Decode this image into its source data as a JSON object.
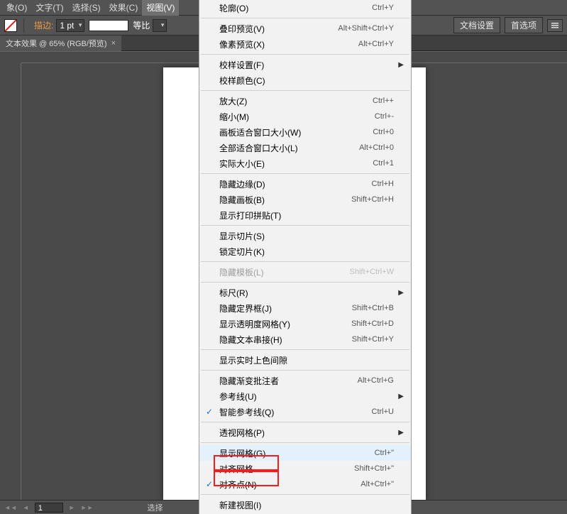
{
  "menubar": {
    "items": [
      {
        "label": "象(O)"
      },
      {
        "label": "文字(T)"
      },
      {
        "label": "选择(S)"
      },
      {
        "label": "效果(C)"
      },
      {
        "label": "视图(V)",
        "active": true
      }
    ]
  },
  "toolbar": {
    "stroke_label": "描边:",
    "stroke_size": "1 pt",
    "uniform_label": "等比",
    "doc_setup": "文档设置",
    "preferences": "首选项"
  },
  "doc_tab": {
    "title": "文本效果 @ 65% (RGB/预览)",
    "close": "×"
  },
  "status": {
    "page": "1",
    "mode_label": "选择"
  },
  "dropdown": {
    "groups": [
      {
        "items": [
          {
            "label": "轮廓(O)",
            "accel": "Ctrl+Y"
          }
        ]
      },
      {
        "items": [
          {
            "label": "叠印预览(V)",
            "accel": "Alt+Shift+Ctrl+Y"
          },
          {
            "label": "像素预览(X)",
            "accel": "Alt+Ctrl+Y"
          }
        ]
      },
      {
        "items": [
          {
            "label": "校样设置(F)",
            "submenu": true
          },
          {
            "label": "校样颜色(C)"
          }
        ]
      },
      {
        "items": [
          {
            "label": "放大(Z)",
            "accel": "Ctrl++"
          },
          {
            "label": "缩小(M)",
            "accel": "Ctrl+-"
          },
          {
            "label": "画板适合窗口大小(W)",
            "accel": "Ctrl+0"
          },
          {
            "label": "全部适合窗口大小(L)",
            "accel": "Alt+Ctrl+0"
          },
          {
            "label": "实际大小(E)",
            "accel": "Ctrl+1"
          }
        ]
      },
      {
        "items": [
          {
            "label": "隐藏边缘(D)",
            "accel": "Ctrl+H"
          },
          {
            "label": "隐藏画板(B)",
            "accel": "Shift+Ctrl+H"
          },
          {
            "label": "显示打印拼贴(T)"
          }
        ]
      },
      {
        "items": [
          {
            "label": "显示切片(S)"
          },
          {
            "label": "锁定切片(K)"
          }
        ]
      },
      {
        "items": [
          {
            "label": "隐藏模板(L)",
            "accel": "Shift+Ctrl+W",
            "disabled": true
          }
        ]
      },
      {
        "items": [
          {
            "label": "标尺(R)",
            "submenu": true
          },
          {
            "label": "隐藏定界框(J)",
            "accel": "Shift+Ctrl+B"
          },
          {
            "label": "显示透明度网格(Y)",
            "accel": "Shift+Ctrl+D"
          },
          {
            "label": "隐藏文本串接(H)",
            "accel": "Shift+Ctrl+Y"
          }
        ]
      },
      {
        "items": [
          {
            "label": "显示实时上色间隙"
          }
        ]
      },
      {
        "items": [
          {
            "label": "隐藏渐变批注者",
            "accel": "Alt+Ctrl+G"
          },
          {
            "label": "参考线(U)",
            "submenu": true
          },
          {
            "label": "智能参考线(Q)",
            "accel": "Ctrl+U",
            "checked": true
          }
        ]
      },
      {
        "items": [
          {
            "label": "透视网格(P)",
            "submenu": true
          }
        ]
      },
      {
        "items": [
          {
            "label": "显示网格(G)",
            "accel": "Ctrl+\"",
            "highlight": true
          },
          {
            "label": "对齐网格",
            "accel": "Shift+Ctrl+\""
          },
          {
            "label": "对齐点(N)",
            "accel": "Alt+Ctrl+\"",
            "checked": true
          }
        ]
      },
      {
        "items": [
          {
            "label": "新建视图(I)"
          }
        ]
      }
    ]
  }
}
